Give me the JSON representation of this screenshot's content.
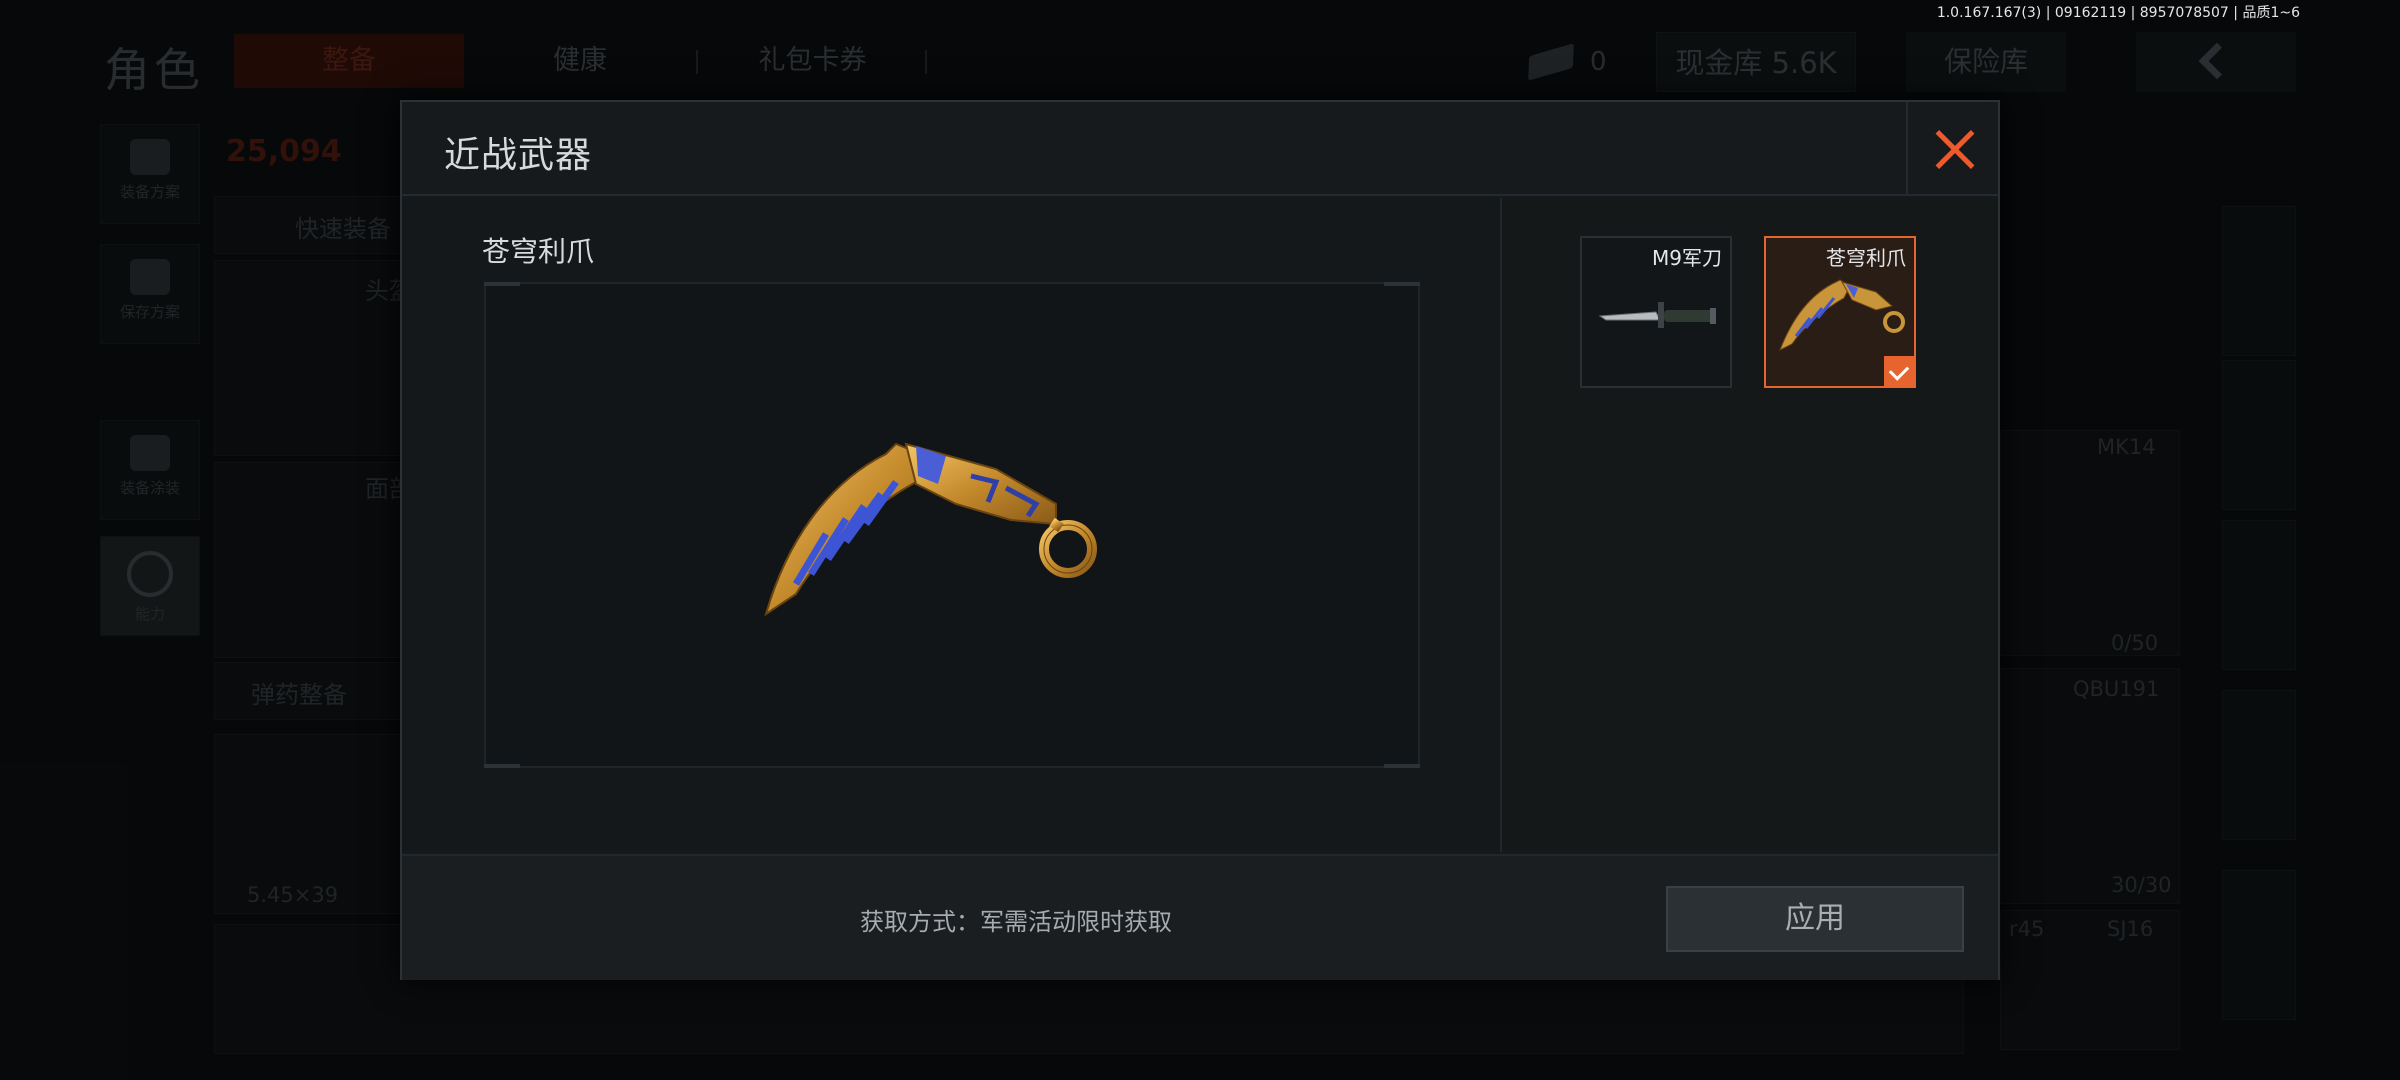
{
  "version_info": "1.0.167.167(3) | 09162119 | 8957078507 | 品质1~6",
  "background": {
    "page_title": "角色",
    "tabs": [
      "整备",
      "健康",
      "礼包卡券"
    ],
    "ticket_count": "0",
    "cash_label": "现金库 5.6K",
    "safe_label": "保险库",
    "currency_value": "25,094",
    "left_rail": [
      "装备方案",
      "保存方案",
      "装备涂装",
      "能力"
    ],
    "quick_equip": "快速装备",
    "helmet_label": "头盔",
    "mask_label": "面部",
    "ammo_equip": "弹药整备",
    "ammo_caliber": "5.45×39",
    "weapons": [
      "MK14",
      "QBU191",
      "SJ16"
    ],
    "ammo_counts": [
      "0/50",
      "30/30"
    ],
    "partial_weapon": "r45"
  },
  "modal": {
    "title": "近战武器",
    "selected_item_name": "苍穹利爪",
    "skins": [
      {
        "label": "M9军刀",
        "selected": false
      },
      {
        "label": "苍穹利爪",
        "selected": true
      }
    ],
    "acquire_text": "获取方式：军需活动限时获取",
    "apply_label": "应用"
  },
  "colors": {
    "accent": "#e8642f",
    "close": "#ee5a2b",
    "gold": "#c9953a",
    "blue_gem": "#4a5fd6"
  },
  "icons": {
    "close": "close-icon",
    "check": "check-icon",
    "back": "chevron-left-icon"
  }
}
